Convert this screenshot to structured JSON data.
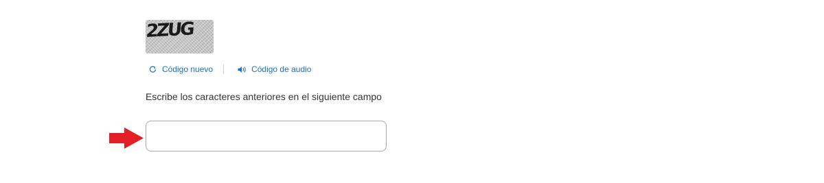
{
  "captcha": {
    "image_text": "2ZUG",
    "refresh_label": "Código nuevo",
    "refresh_icon": "refresh-icon",
    "audio_label": "Código de audio",
    "audio_icon": "speaker-icon",
    "link_color": "#1a6fbf"
  },
  "instruction": {
    "text": "Escribe los caracteres anteriores en el siguiente campo"
  },
  "input": {
    "value": "",
    "placeholder": ""
  },
  "annotation": {
    "arrow_icon": "right-arrow-icon",
    "arrow_color": "#e31e24"
  }
}
